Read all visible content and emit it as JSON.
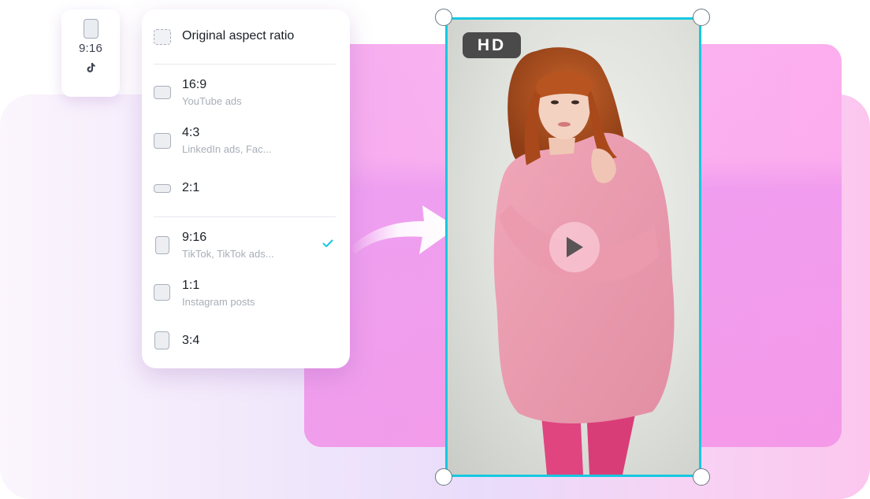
{
  "mini_card": {
    "ratio": "9:16",
    "icon": "tiktok-icon"
  },
  "menu": {
    "items": [
      {
        "label": "Original aspect ratio",
        "sub": "",
        "icon": "dashed-frame-icon",
        "selected": false
      },
      {
        "label": "16:9",
        "sub": "YouTube ads",
        "icon": "landscape-frame-icon",
        "selected": false
      },
      {
        "label": "4:3",
        "sub": "LinkedIn ads, Fac...",
        "icon": "frame-icon",
        "selected": false
      },
      {
        "label": "2:1",
        "sub": "",
        "icon": "wide-frame-icon",
        "selected": false
      },
      {
        "label": "9:16",
        "sub": "TikTok, TikTok ads...",
        "icon": "portrait-frame-icon",
        "selected": true
      },
      {
        "label": "1:1",
        "sub": "Instagram posts",
        "icon": "square-frame-icon",
        "selected": false
      },
      {
        "label": "3:4",
        "sub": "",
        "icon": "portrait-frame-icon",
        "selected": false
      }
    ],
    "check_color": "#16c8e0"
  },
  "preview": {
    "badge": "HD",
    "border_color": "#16c8e0",
    "play_icon": "play-icon",
    "subject": "woman in pink oversized sweater and pink tights"
  }
}
